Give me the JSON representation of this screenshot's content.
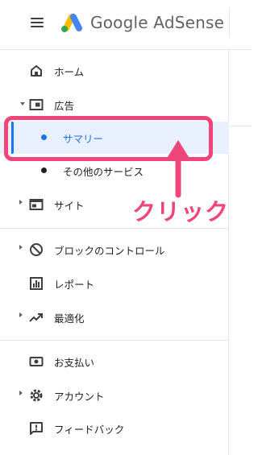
{
  "header": {
    "brand": "Google AdSense"
  },
  "sidebar": {
    "items": [
      {
        "label": "ホーム",
        "icon": "home-icon"
      },
      {
        "label": "広告",
        "icon": "ad-unit-icon",
        "expanded": true,
        "subitems": [
          {
            "label": "サマリー",
            "active": true
          },
          {
            "label": "その他のサービス",
            "active": false
          }
        ]
      },
      {
        "label": "サイト",
        "icon": "sites-icon"
      },
      {
        "label": "ブロックのコントロール",
        "icon": "block-icon"
      },
      {
        "label": "レポート",
        "icon": "report-icon"
      },
      {
        "label": "最適化",
        "icon": "trending-up-icon"
      },
      {
        "label": "お支払い",
        "icon": "payments-icon"
      },
      {
        "label": "アカウント",
        "icon": "gear-icon"
      },
      {
        "label": "フィードバック",
        "icon": "feedback-icon"
      }
    ]
  },
  "annotation": {
    "text": "クリック"
  },
  "colors": {
    "accent": "#1a73e8",
    "active_bg": "#e8f0fe",
    "annotation": "#f0457a"
  }
}
